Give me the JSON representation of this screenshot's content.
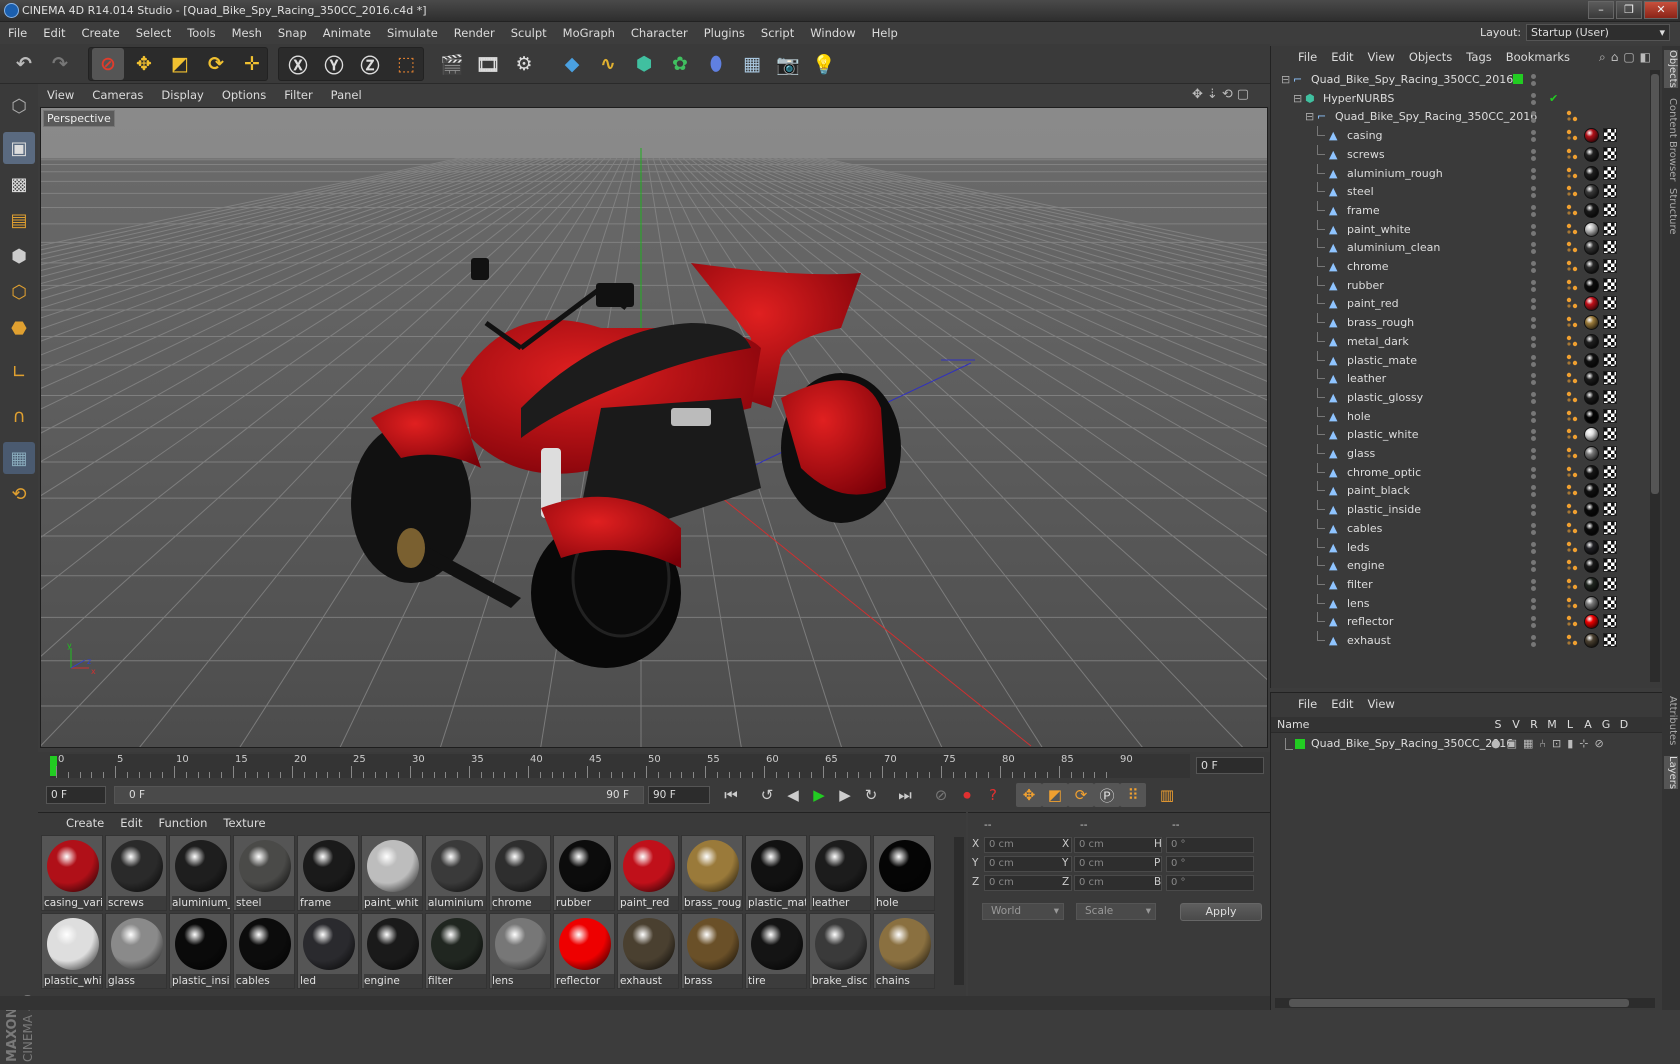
{
  "window": {
    "title": "CINEMA 4D R14.014 Studio - [Quad_Bike_Spy_Racing_350CC_2016.c4d *]"
  },
  "menu": [
    "File",
    "Edit",
    "Create",
    "Select",
    "Tools",
    "Mesh",
    "Snap",
    "Animate",
    "Simulate",
    "Render",
    "Sculpt",
    "MoGraph",
    "Character",
    "Plugins",
    "Script",
    "Window",
    "Help"
  ],
  "layout": {
    "label": "Layout:",
    "value": "Startup (User)"
  },
  "viewport": {
    "menu": [
      "View",
      "Cameras",
      "Display",
      "Options",
      "Filter",
      "Panel"
    ],
    "label": "Perspective"
  },
  "timeline": {
    "ticks": [
      "0",
      "5",
      "10",
      "15",
      "20",
      "25",
      "30",
      "35",
      "40",
      "45",
      "50",
      "55",
      "60",
      "65",
      "70",
      "75",
      "80",
      "85",
      "90"
    ],
    "frame_right": "0 F",
    "start": "0 F",
    "range_start": "0 F",
    "range_end": "90 F",
    "end": "90 F"
  },
  "materials": {
    "menu": [
      "Create",
      "Edit",
      "Function",
      "Texture"
    ],
    "items": [
      {
        "name": "casing_vari",
        "color": "#b01018"
      },
      {
        "name": "screws",
        "color": "#2a2a2a"
      },
      {
        "name": "aluminium_",
        "color": "#1e1e1e"
      },
      {
        "name": "steel",
        "color": "#4a4a48"
      },
      {
        "name": "frame",
        "color": "#1a1a1a"
      },
      {
        "name": "paint_whit",
        "color": "#bdbdbd"
      },
      {
        "name": "aluminium",
        "color": "#3a3a3a"
      },
      {
        "name": "chrome",
        "color": "#2e2e2e"
      },
      {
        "name": "rubber",
        "color": "#0c0c0c"
      },
      {
        "name": "paint_red",
        "color": "#c0101a"
      },
      {
        "name": "brass_roug",
        "color": "#9a7a3a"
      },
      {
        "name": "plastic_mat",
        "color": "#111111"
      },
      {
        "name": "leather",
        "color": "#1c1c1c"
      },
      {
        "name": "hole",
        "color": "#050505"
      },
      {
        "name": "plastic_whi",
        "color": "#dedede"
      },
      {
        "name": "glass",
        "color": "#8a8a8a"
      },
      {
        "name": "plastic_insi",
        "color": "#0a0a0a"
      },
      {
        "name": "cables",
        "color": "#0c0c0c"
      },
      {
        "name": "led",
        "color": "#2a2a2e"
      },
      {
        "name": "engine",
        "color": "#1a1a1a"
      },
      {
        "name": "filter",
        "color": "#202620"
      },
      {
        "name": "lens",
        "color": "#777777"
      },
      {
        "name": "reflector",
        "color": "#ee0000"
      },
      {
        "name": "exhaust",
        "color": "#4a4030"
      },
      {
        "name": "brass",
        "color": "#6a5028"
      },
      {
        "name": "tire",
        "color": "#141414"
      },
      {
        "name": "brake_disc",
        "color": "#3a3a3a"
      },
      {
        "name": "chains",
        "color": "#8a7040"
      }
    ]
  },
  "coords": {
    "headers": [
      "--",
      "--",
      "--"
    ],
    "rows": [
      {
        "a": "X",
        "av": "0 cm",
        "b": "X",
        "bv": "0 cm",
        "c": "H",
        "cv": "0 °"
      },
      {
        "a": "Y",
        "av": "0 cm",
        "b": "Y",
        "bv": "0 cm",
        "c": "P",
        "cv": "0 °"
      },
      {
        "a": "Z",
        "av": "0 cm",
        "b": "Z",
        "bv": "0 cm",
        "c": "B",
        "cv": "0 °"
      }
    ],
    "space": "World",
    "mode": "Scale",
    "apply": "Apply"
  },
  "objects": {
    "menu": [
      "File",
      "Edit",
      "View",
      "Objects",
      "Tags",
      "Bookmarks"
    ],
    "root": "Quad_Bike_Spy_Racing_350CC_2016",
    "hypernurbs": "HyperNURBS",
    "group": "Quad_Bike_Spy_Racing_350CC_2016",
    "children": [
      {
        "name": "casing",
        "color": "#b01018"
      },
      {
        "name": "screws",
        "color": "#222222"
      },
      {
        "name": "aluminium_rough",
        "color": "#1e1e1e"
      },
      {
        "name": "steel",
        "color": "#3a3a3a"
      },
      {
        "name": "frame",
        "color": "#1a1a1a"
      },
      {
        "name": "paint_white",
        "color": "#c0c0c0"
      },
      {
        "name": "aluminium_clean",
        "color": "#333333"
      },
      {
        "name": "chrome",
        "color": "#2a2a2a"
      },
      {
        "name": "rubber",
        "color": "#0c0c0c"
      },
      {
        "name": "paint_red",
        "color": "#c0101a"
      },
      {
        "name": "brass_rough",
        "color": "#9a7a3a"
      },
      {
        "name": "metal_dark",
        "color": "#202020"
      },
      {
        "name": "plastic_mate",
        "color": "#111111"
      },
      {
        "name": "leather",
        "color": "#1c1c1c"
      },
      {
        "name": "plastic_glossy",
        "color": "#1a1a1a"
      },
      {
        "name": "hole",
        "color": "#050505"
      },
      {
        "name": "plastic_white",
        "color": "#dedede"
      },
      {
        "name": "glass",
        "color": "#777777"
      },
      {
        "name": "chrome_optic",
        "color": "#151515"
      },
      {
        "name": "paint_black",
        "color": "#111111"
      },
      {
        "name": "plastic_inside",
        "color": "#0a0a0a"
      },
      {
        "name": "cables",
        "color": "#0c0c0c"
      },
      {
        "name": "leds",
        "color": "#222226"
      },
      {
        "name": "engine",
        "color": "#1a1a1a"
      },
      {
        "name": "filter",
        "color": "#202620"
      },
      {
        "name": "lens",
        "color": "#777777"
      },
      {
        "name": "reflector",
        "color": "#ee0000"
      },
      {
        "name": "exhaust",
        "color": "#4a4030"
      }
    ]
  },
  "layers": {
    "menu": [
      "File",
      "Edit",
      "View"
    ],
    "header_name": "Name",
    "columns": [
      "S",
      "V",
      "R",
      "M",
      "L",
      "A",
      "G",
      "D"
    ],
    "row": "Quad_Bike_Spy_Racing_350CC_2016"
  },
  "side_tabs": [
    "Objects",
    "Content Browser",
    "Structure",
    "Attributes",
    "Layers"
  ],
  "brand": {
    "maxon": "MAXON",
    "c4d": "CINEMA 4D"
  },
  "colors": {
    "accent_green": "#22cc22",
    "axis_red": "#d03030",
    "axis_green": "#20b020",
    "axis_blue": "#3030c0"
  }
}
